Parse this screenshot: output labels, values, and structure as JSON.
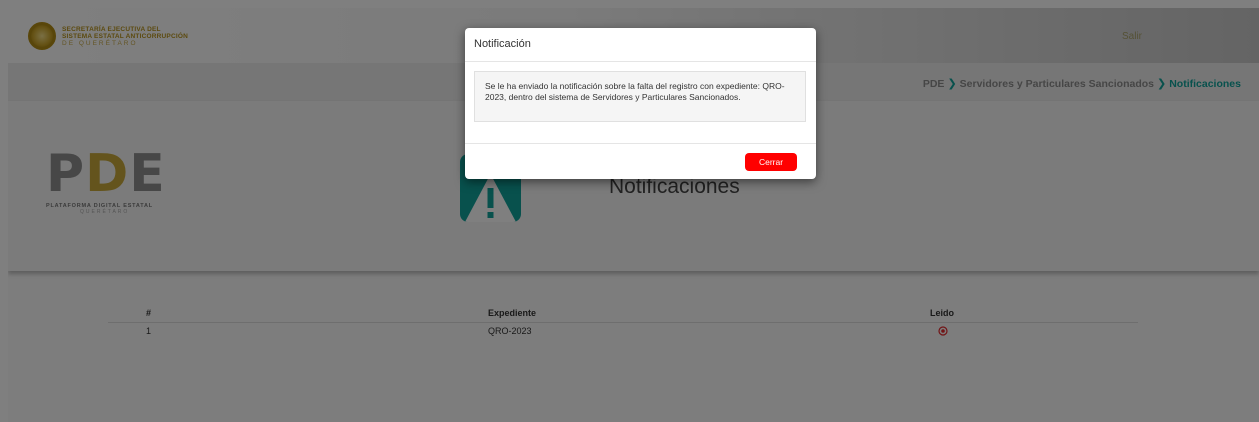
{
  "header": {
    "logo_lines": [
      "SECRETARÍA EJECUTIVA DEL",
      "SISTEMA ESTATAL ANTICORRUPCIÓN",
      "DE QUERÉTARO"
    ],
    "logout_label": "Salir"
  },
  "breadcrumb": {
    "items": [
      "PDE",
      "Servidores y Particulares Sancionados",
      "Notificaciones"
    ],
    "separator_icon": "chevron-right-icon",
    "active_color": "#11a39b"
  },
  "hero": {
    "brand_letters": [
      "P",
      "D",
      "E"
    ],
    "brand_caption": "PLATAFORMA DIGITAL ESTATAL",
    "brand_subcaption": "QUERÉTARO",
    "title": "Notificaciones",
    "tile_icon": "warning-icon",
    "tile_color": "#11a39b"
  },
  "table": {
    "columns": [
      "#",
      "Expediente",
      "Leido"
    ],
    "rows": [
      {
        "index": "1",
        "expediente": "QRO-2023",
        "read_icon": "unread-circle-icon"
      }
    ]
  },
  "modal": {
    "title": "Notificación",
    "message": "Se le ha enviado la notificación sobre la falta del registro con expediente: QRO-2023, dentro del sistema de Servidores y Particulares Sancionados.",
    "close_label": "Cerrar",
    "close_color": "#ff0000"
  }
}
